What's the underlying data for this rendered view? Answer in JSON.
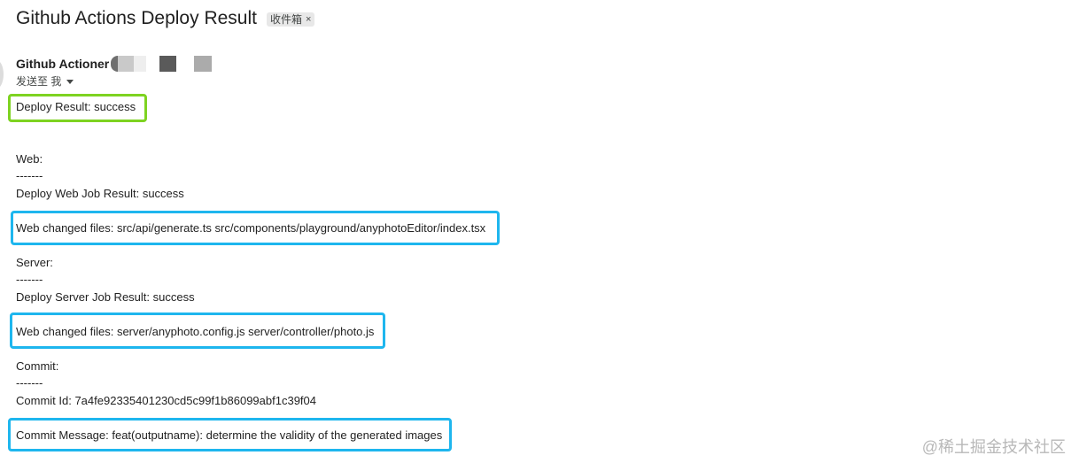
{
  "email": {
    "subject": "Github Actions Deploy Result",
    "label": "收件箱",
    "label_close": "×",
    "sender_name": "Github Actioner",
    "recipient_text": "发送至 我"
  },
  "body": {
    "deploy_result": "Deploy Result: success",
    "web_heading": "Web:",
    "web_separator": "-------",
    "web_job_result": "Deploy Web Job Result: success",
    "web_changed_files": "Web changed files: src/api/generate.ts src/components/playground/anyphotoEditor/index.tsx",
    "server_heading": "Server:",
    "server_separator": "-------",
    "server_job_result": "Deploy Server Job Result: success",
    "server_changed_files": "Web changed files: server/anyphoto.config.js server/controller/photo.js",
    "commit_heading": "Commit:",
    "commit_separator": "-------",
    "commit_id": "Commit Id: 7a4fe92335401230cd5c99f1b86099abf1c39f04",
    "commit_message": "Commit Message: feat(outputname): determine the validity of the generated images"
  },
  "watermark": "@稀土掘金技术社区",
  "colors": {
    "highlight_green": "#7ed321",
    "highlight_blue": "#1eb6ee"
  }
}
